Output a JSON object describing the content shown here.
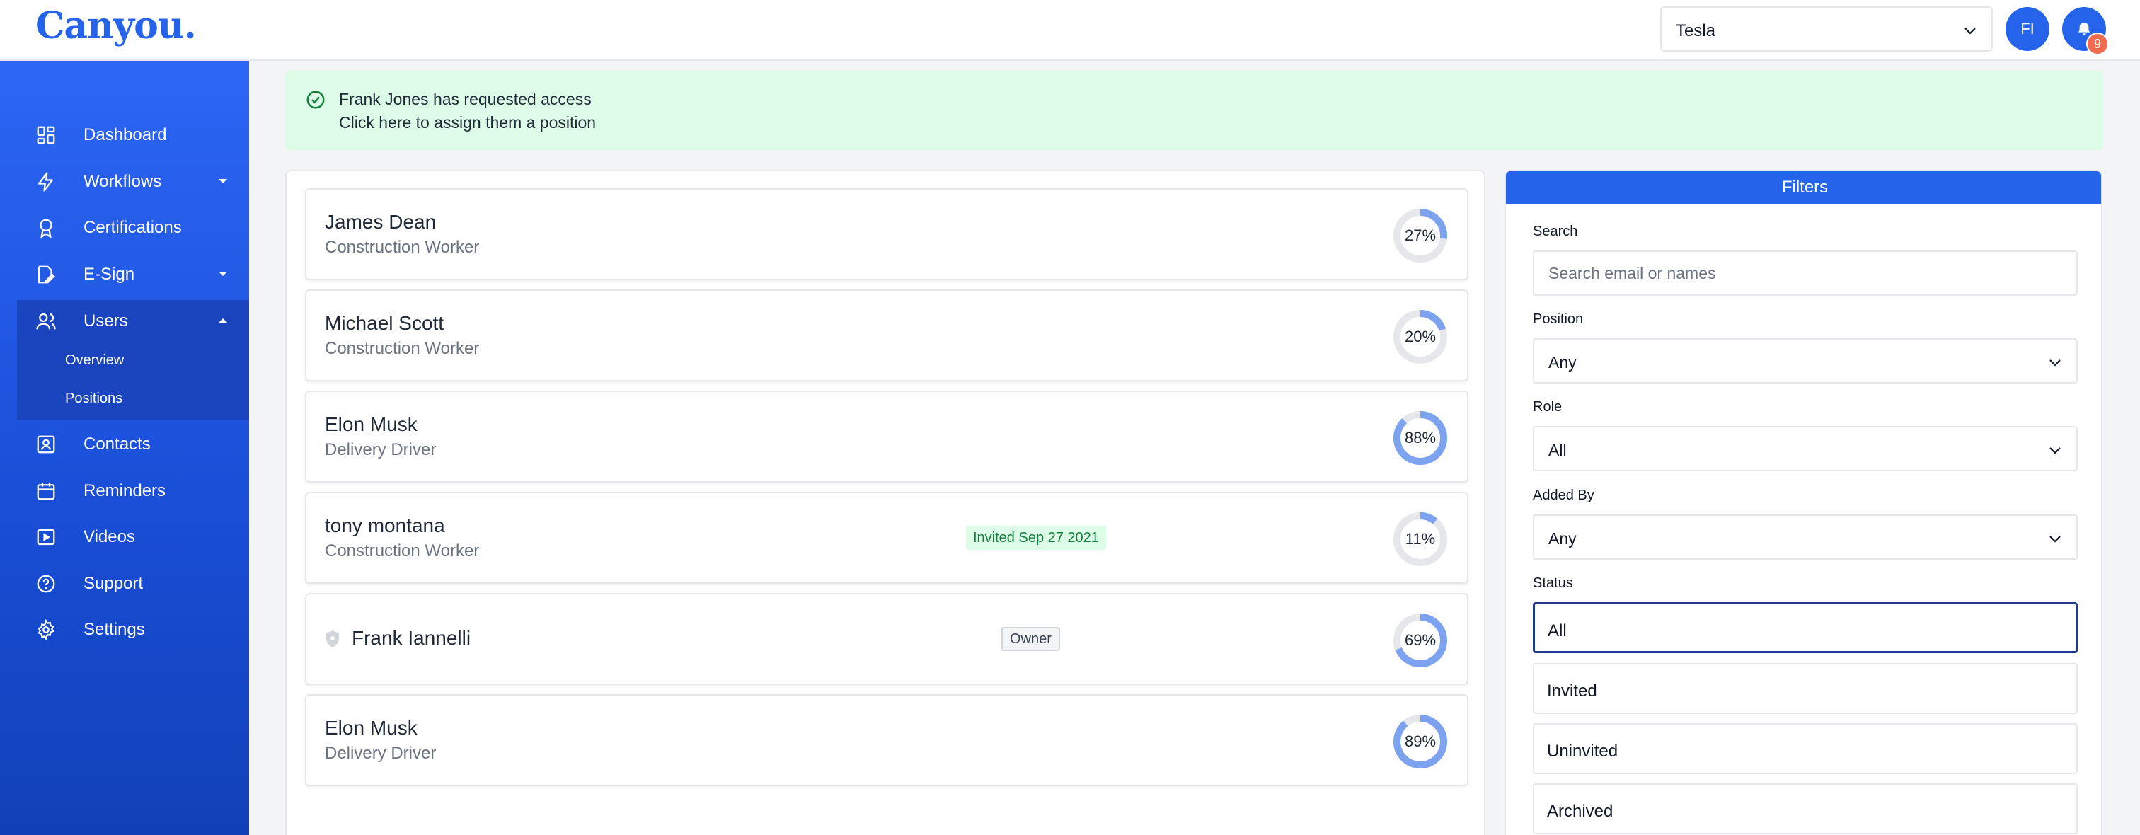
{
  "app": {
    "brand": "Canyou."
  },
  "header": {
    "org_select": "Tesla",
    "avatar_initials": "FI",
    "notification_count": "9"
  },
  "sidebar": {
    "items": [
      {
        "label": "Dashboard",
        "icon": "dashboard-icon"
      },
      {
        "label": "Workflows",
        "icon": "lightning-icon"
      },
      {
        "label": "Certifications",
        "icon": "award-icon"
      },
      {
        "label": "E-Sign",
        "icon": "signature-icon"
      },
      {
        "label": "Users",
        "icon": "users-icon"
      },
      {
        "label": "Contacts",
        "icon": "contact-card-icon"
      },
      {
        "label": "Reminders",
        "icon": "calendar-icon"
      },
      {
        "label": "Videos",
        "icon": "video-icon"
      },
      {
        "label": "Support",
        "icon": "help-circle-icon"
      },
      {
        "label": "Settings",
        "icon": "gear-icon"
      }
    ],
    "users_subitems": [
      "Overview",
      "Positions"
    ]
  },
  "alert": {
    "line1": "Frank Jones has requested access",
    "line2": "Click here to assign them a position"
  },
  "users": [
    {
      "name": "James Dean",
      "role": "Construction Worker",
      "progress": 27,
      "progress_label": "27%"
    },
    {
      "name": "Michael Scott",
      "role": "Construction Worker",
      "progress": 20,
      "progress_label": "20%"
    },
    {
      "name": "Elon Musk",
      "role": "Delivery Driver",
      "progress": 88,
      "progress_label": "88%"
    },
    {
      "name": "tony montana",
      "role": "Construction Worker",
      "badge": "Invited Sep 27 2021",
      "progress": 11,
      "progress_label": "11%"
    },
    {
      "name": "Frank Iannelli",
      "badge": "Owner",
      "progress": 69,
      "progress_label": "69%"
    },
    {
      "name": "Elon Musk",
      "role": "Delivery Driver",
      "progress": 89,
      "progress_label": "89%"
    }
  ],
  "filters": {
    "title": "Filters",
    "search_label": "Search",
    "search_placeholder": "Search email or names",
    "position_label": "Position",
    "position_value": "Any",
    "role_label": "Role",
    "role_value": "All",
    "added_by_label": "Added By",
    "added_by_value": "Any",
    "status_label": "Status",
    "status_options": [
      "All",
      "Invited",
      "Uninvited",
      "Archived"
    ],
    "status_selected": "All"
  },
  "colors": {
    "accent": "#2563eb",
    "sidebar_top": "#2d66f5",
    "sidebar_bottom": "#1240b8",
    "alert_bg": "#dcfce7",
    "ring_fill": "#7da2f0",
    "ring_track": "#e5e7eb",
    "badge": "#f26b4f"
  }
}
